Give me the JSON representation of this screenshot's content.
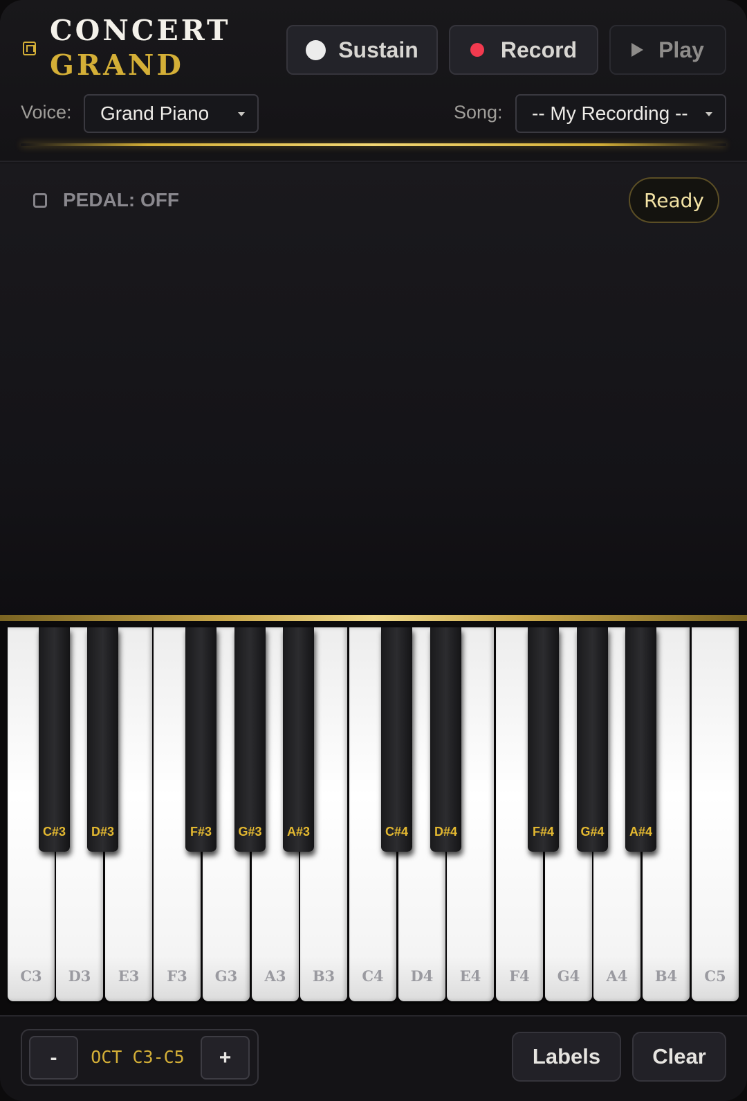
{
  "logo": {
    "line1": "CONCERT",
    "line2": "GRAND",
    "icon": "piano-icon"
  },
  "controls": {
    "sustain_label": "Sustain",
    "record_label": "Record",
    "play_label": "Play"
  },
  "voice": {
    "label": "Voice:",
    "value": "Grand Piano"
  },
  "song": {
    "label": "Song:",
    "value": "-- My Recording --"
  },
  "pedal": {
    "text": "PEDAL: OFF"
  },
  "status": {
    "text": "Ready"
  },
  "keyboard": {
    "white_keys": [
      "C3",
      "D3",
      "E3",
      "F3",
      "G3",
      "A3",
      "B3",
      "C4",
      "D4",
      "E4",
      "F4",
      "G4",
      "A4",
      "B4",
      "C5"
    ],
    "black_keys": [
      "C#3",
      "D#3",
      "F#3",
      "G#3",
      "A#3",
      "C#4",
      "D#4",
      "F#4",
      "G#4",
      "A#4"
    ]
  },
  "footer": {
    "octave_minus": "-",
    "octave_label": "OCT C3-C5",
    "octave_plus": "+",
    "labels_button": "Labels",
    "clear_button": "Clear"
  },
  "colors": {
    "accent_gold": "#d4af37",
    "record_red": "#f23a4f",
    "background": "#161518"
  }
}
